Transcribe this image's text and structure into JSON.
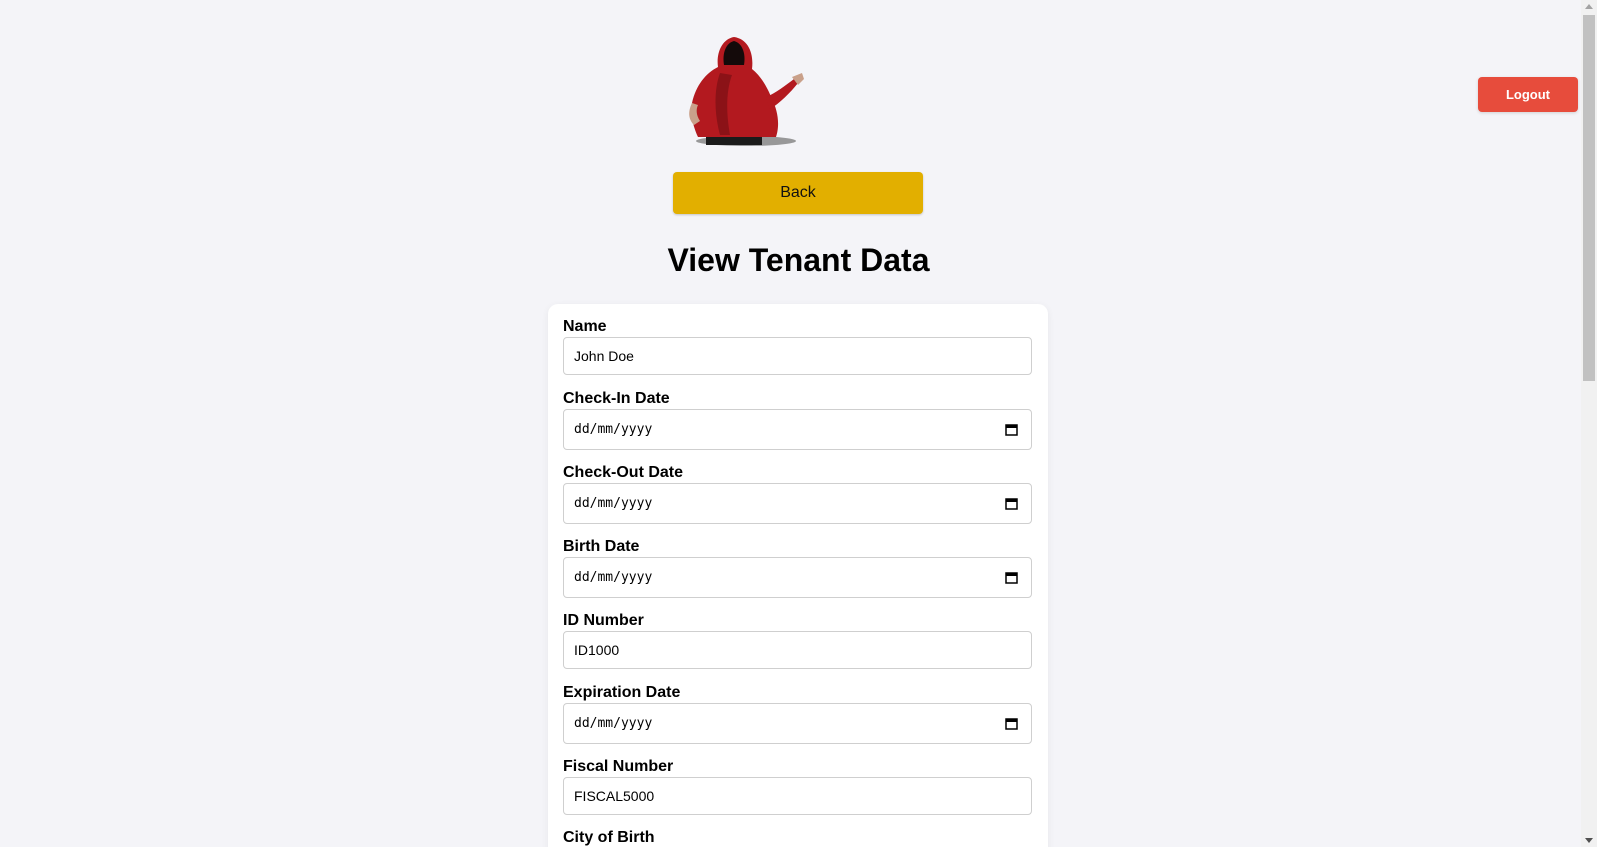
{
  "header": {
    "logo_name": "hooded-figure-logo",
    "logout_label": "Logout",
    "back_label": "Back"
  },
  "page": {
    "title": "View Tenant Data"
  },
  "form": {
    "fields": [
      {
        "label": "Name",
        "type": "text",
        "value": "John Doe"
      },
      {
        "label": "Check-In Date",
        "type": "date",
        "value": "dd/mm/yyyy"
      },
      {
        "label": "Check-Out Date",
        "type": "date",
        "value": "dd/mm/yyyy"
      },
      {
        "label": "Birth Date",
        "type": "date",
        "value": "dd/mm/yyyy"
      },
      {
        "label": "ID Number",
        "type": "text",
        "value": "ID1000"
      },
      {
        "label": "Expiration Date",
        "type": "date",
        "value": "dd/mm/yyyy"
      },
      {
        "label": "Fiscal Number",
        "type": "text",
        "value": "FISCAL5000"
      },
      {
        "label": "City of Birth",
        "type": "text",
        "value": ""
      }
    ]
  },
  "colors": {
    "background": "#f4f4f8",
    "logout": "#e74c3c",
    "back": "#e2af00"
  }
}
